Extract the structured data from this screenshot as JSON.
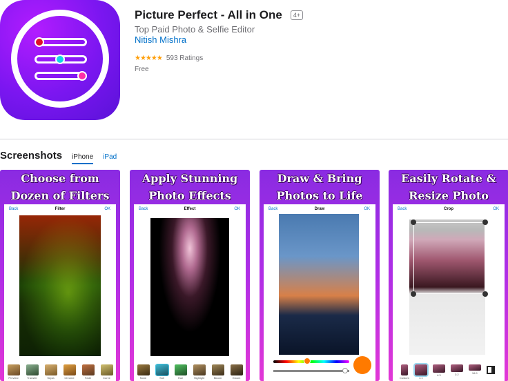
{
  "app": {
    "title": "Picture Perfect - All in One",
    "age_rating": "4+",
    "subtitle": "Top Paid Photo & Selfie Editor",
    "developer": "Nitish Mishra",
    "stars": "★★★★★",
    "ratings_count": "593 Ratings",
    "price": "Free"
  },
  "screenshots_section": {
    "title": "Screenshots",
    "tabs": [
      {
        "label": "iPhone"
      },
      {
        "label": "iPad"
      }
    ]
  },
  "screenshots": [
    {
      "caption_line1": "Choose from",
      "caption_line2": "Dozen of  Filters",
      "back": "Back",
      "screen_title": "Filter",
      "ok": "OK",
      "thumbs": [
        "Preview",
        "Transfer",
        "Sepia",
        "Chrome",
        "Fade",
        "Curve"
      ]
    },
    {
      "caption_line1": "Apply Stunning",
      "caption_line2": "Photo Effects",
      "back": "Back",
      "screen_title": "Effect",
      "ok": "OK",
      "thumbs": [
        "None",
        "Soil",
        "Hue",
        "Highlight",
        "Bloom",
        "Gloom"
      ]
    },
    {
      "caption_line1": "Draw & Bring",
      "caption_line2": "Photos to Life",
      "back": "Back",
      "screen_title": "Draw",
      "ok": "OK",
      "thumbs": []
    },
    {
      "caption_line1": "Easily Rotate &",
      "caption_line2": "Resize Photo",
      "back": "Back",
      "screen_title": "Crop",
      "ok": "OK",
      "thumbs": [
        "Custom",
        "1:1",
        "4:3",
        "3:2",
        "16:9"
      ]
    }
  ],
  "colors": {
    "accent": "#0070c9",
    "star": "#ff9f0a",
    "icon_bg": "#7a16f0",
    "shot_bg_top": "#8a2be2",
    "shot_bg_bottom": "#e237d6",
    "draw_color_swatch": "#ff7a00"
  }
}
